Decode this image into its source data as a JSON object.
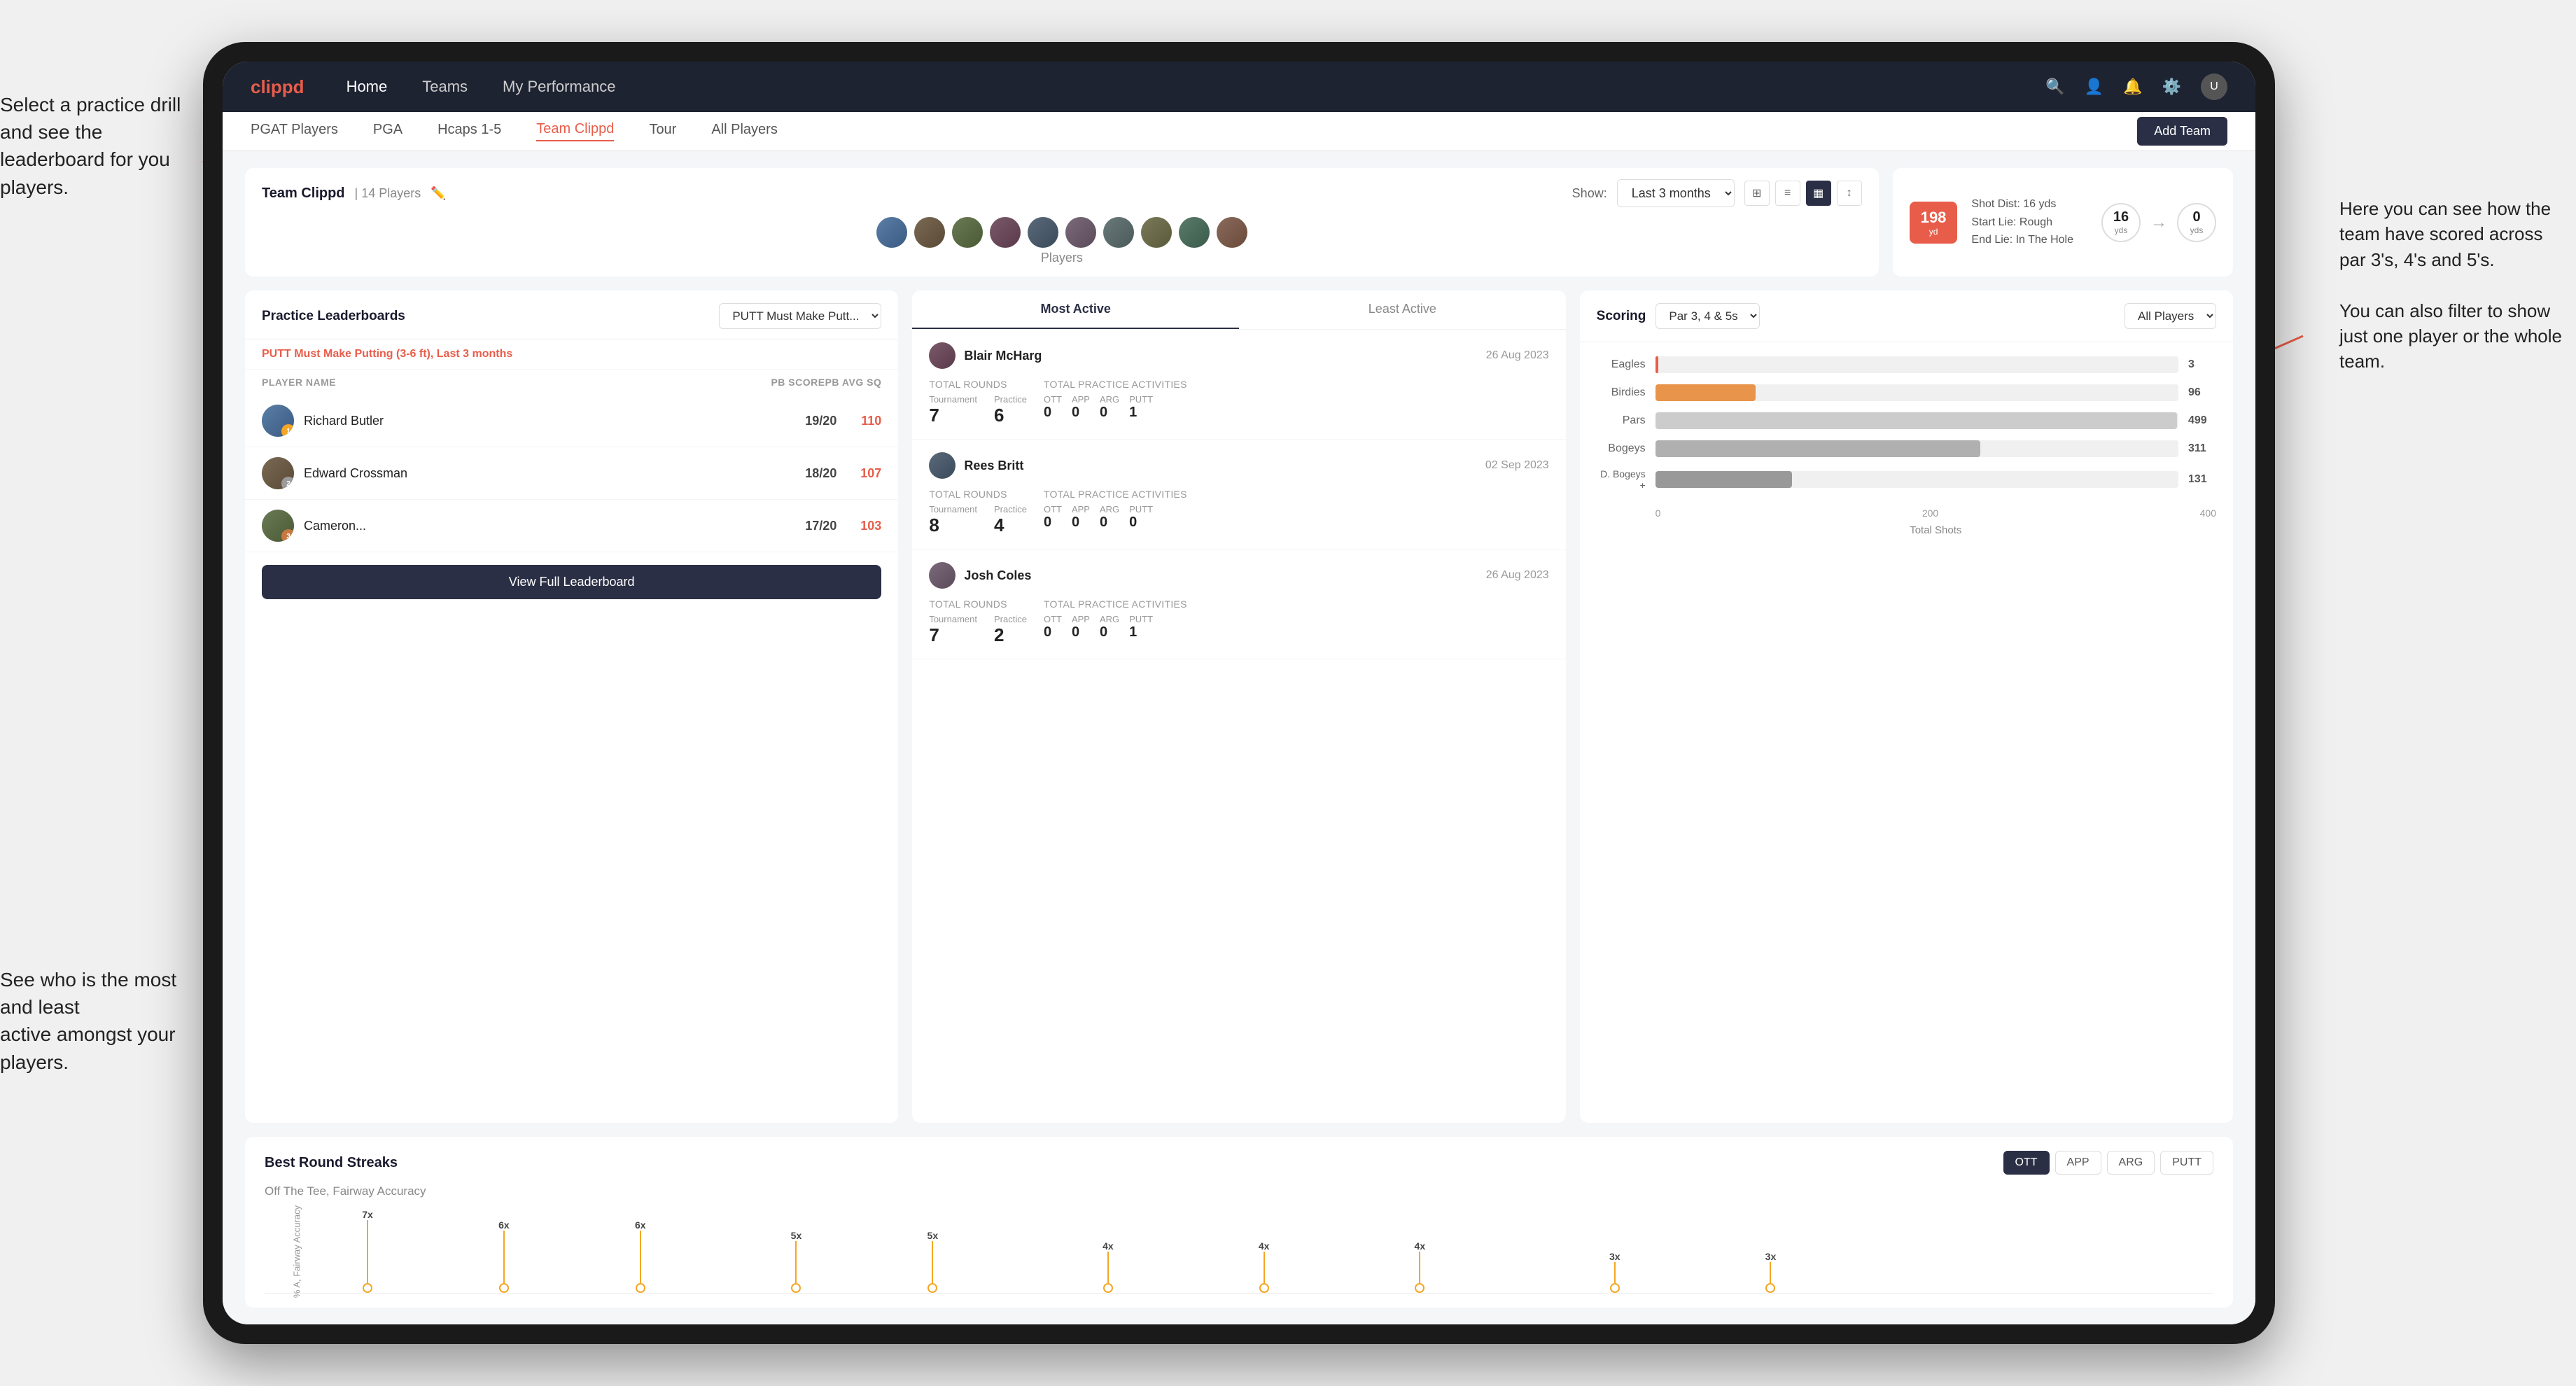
{
  "annotations": {
    "top_left": "Select a practice drill and see\nthe leaderboard for you players.",
    "bottom_left": "See who is the most and least\nactive amongst your players.",
    "right": "Here you can see how the\nteam have scored across\npar 3's, 4's and 5's.\n\nYou can also filter to show\njust one player or the whole\nteam."
  },
  "nav": {
    "logo": "clippd",
    "links": [
      "Home",
      "Teams",
      "My Performance"
    ],
    "icons": [
      "search",
      "person",
      "bell",
      "settings",
      "avatar"
    ]
  },
  "sub_nav": {
    "links": [
      "PGAT Players",
      "PGA",
      "Hcaps 1-5",
      "Team Clippd",
      "Tour",
      "All Players"
    ],
    "active": "Team Clippd",
    "add_team": "Add Team"
  },
  "team_header": {
    "title": "Team Clippd",
    "count": "14 Players",
    "players_label": "Players",
    "show_label": "Show:",
    "show_period": "Last 3 months"
  },
  "shot_card": {
    "distance": "198",
    "distance_unit": "yd",
    "start_lie": "Rough",
    "end_lie": "In The Hole",
    "shot_dist_label": "Shot Dist: 16 yds",
    "start_lie_label": "Start Lie: Rough",
    "end_lie_label": "End Lie: In The Hole",
    "circle1_val": "16",
    "circle1_unit": "yds",
    "circle2_val": "0",
    "circle2_unit": "yds"
  },
  "practice_leaderboards": {
    "title": "Practice Leaderboards",
    "drill": "PUTT Must Make Putt...",
    "subtitle": "PUTT Must Make Putting (3-6 ft),",
    "period": "Last 3 months",
    "col_player": "PLAYER NAME",
    "col_score": "PB SCORE",
    "col_avg": "PB AVG SQ",
    "rows": [
      {
        "rank": 1,
        "name": "Richard Butler",
        "score": "19/20",
        "avg": "110",
        "badge": "gold"
      },
      {
        "rank": 2,
        "name": "Edward Crossman",
        "score": "18/20",
        "avg": "107",
        "badge": "silver"
      },
      {
        "rank": 3,
        "name": "Cameron...",
        "score": "17/20",
        "avg": "103",
        "badge": "bronze"
      }
    ],
    "view_full": "View Full Leaderboard"
  },
  "activity": {
    "tabs": [
      "Most Active",
      "Least Active"
    ],
    "active_tab": "Most Active",
    "players": [
      {
        "name": "Blair McHarg",
        "date": "26 Aug 2023",
        "total_rounds_label": "Total Rounds",
        "tournament": "7",
        "practice": "6",
        "total_practice_label": "Total Practice Activities",
        "ott": "0",
        "app": "0",
        "arg": "0",
        "putt": "1"
      },
      {
        "name": "Rees Britt",
        "date": "02 Sep 2023",
        "total_rounds_label": "Total Rounds",
        "tournament": "8",
        "practice": "4",
        "total_practice_label": "Total Practice Activities",
        "ott": "0",
        "app": "0",
        "arg": "0",
        "putt": "0"
      },
      {
        "name": "Josh Coles",
        "date": "26 Aug 2023",
        "total_rounds_label": "Total Rounds",
        "tournament": "7",
        "practice": "2",
        "total_practice_label": "Total Practice Activities",
        "ott": "0",
        "app": "0",
        "arg": "0",
        "putt": "1"
      }
    ]
  },
  "scoring": {
    "title": "Scoring",
    "filter": "Par 3, 4 & 5s",
    "players_filter": "All Players",
    "bars": [
      {
        "label": "Eagles",
        "value": 3,
        "max": 500,
        "color": "eagles"
      },
      {
        "label": "Birdies",
        "value": 96,
        "max": 500,
        "color": "birdies"
      },
      {
        "label": "Pars",
        "value": 499,
        "max": 500,
        "color": "pars"
      },
      {
        "label": "Bogeys",
        "value": 311,
        "max": 500,
        "color": "bogeys"
      },
      {
        "label": "D. Bogeys +",
        "value": 131,
        "max": 500,
        "color": "dbogeys"
      }
    ],
    "x_axis": [
      "0",
      "200",
      "400"
    ],
    "x_label": "Total Shots"
  },
  "best_round_streaks": {
    "title": "Best Round Streaks",
    "subtitle": "Off The Tee, Fairway Accuracy",
    "buttons": [
      "OTT",
      "APP",
      "ARG",
      "PUTT"
    ],
    "active_btn": "OTT",
    "points": [
      {
        "x": 5,
        "label": "7x",
        "height": 90
      },
      {
        "x": 12,
        "label": "6x",
        "height": 75
      },
      {
        "x": 19,
        "label": "6x",
        "height": 75
      },
      {
        "x": 27,
        "label": "5x",
        "height": 60
      },
      {
        "x": 34,
        "label": "5x",
        "height": 60
      },
      {
        "x": 42,
        "label": "4x",
        "height": 45
      },
      {
        "x": 49,
        "label": "4x",
        "height": 45
      },
      {
        "x": 56,
        "label": "4x",
        "height": 45
      },
      {
        "x": 65,
        "label": "3x",
        "height": 30
      },
      {
        "x": 72,
        "label": "3x",
        "height": 30
      }
    ]
  }
}
